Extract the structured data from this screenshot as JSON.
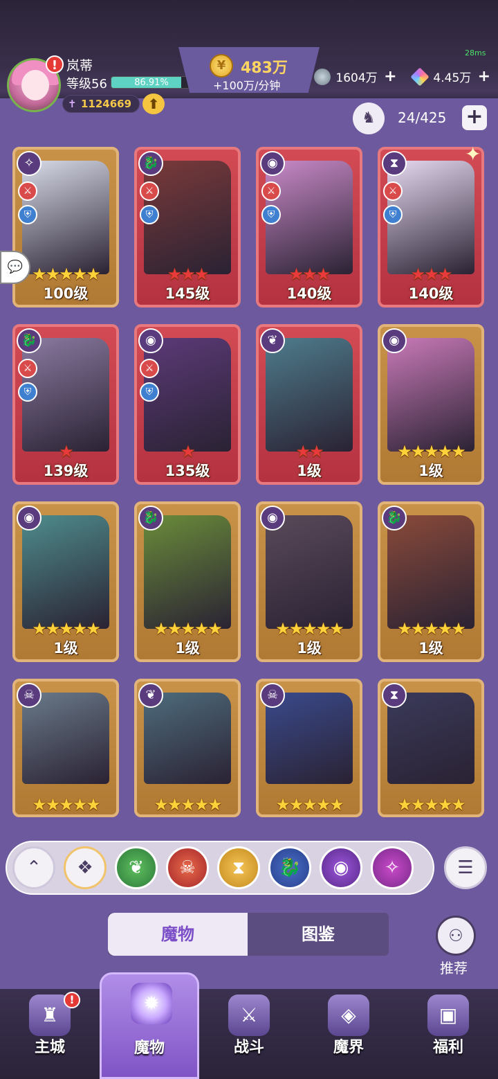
{
  "player": {
    "name": "岚蒂",
    "level_label": "等级56",
    "xp_percent_text": "86.91%",
    "xp_fraction": 0.8691,
    "power": "1124669",
    "alert_badge": "!"
  },
  "currency": {
    "gold_amount": "483万",
    "gold_rate": "+100万/分钟",
    "silver_amount": "1604万",
    "gem_amount": "4.45万",
    "plus": "+"
  },
  "ping": "28ms",
  "capacity": {
    "text": "24/425",
    "plus": "+"
  },
  "cards": [
    {
      "level": "100级",
      "stars": 5,
      "star_color": "gold",
      "frame": "gold",
      "faction_icon": "void-rune-icon",
      "show_class": true
    },
    {
      "level": "145级",
      "stars": 3,
      "star_color": "red",
      "frame": "red",
      "faction_icon": "dragon-icon",
      "show_class": true
    },
    {
      "level": "140级",
      "stars": 3,
      "star_color": "red",
      "frame": "red",
      "faction_icon": "eye-icon",
      "show_class": true
    },
    {
      "level": "140级",
      "stars": 3,
      "star_color": "red",
      "frame": "red",
      "faction_icon": "hourglass-icon",
      "show_class": true
    },
    {
      "level": "139级",
      "stars": 1,
      "star_color": "red",
      "frame": "red",
      "faction_icon": "dragon-icon",
      "show_class": true
    },
    {
      "level": "135级",
      "stars": 1,
      "star_color": "red",
      "frame": "red",
      "faction_icon": "eye-icon",
      "show_class": true
    },
    {
      "level": "1级",
      "stars": 2,
      "star_color": "red",
      "frame": "red",
      "faction_icon": "leaf-icon",
      "show_class": false
    },
    {
      "level": "1级",
      "stars": 5,
      "star_color": "gold",
      "frame": "gold",
      "faction_icon": "eye-icon",
      "show_class": false
    },
    {
      "level": "1级",
      "stars": 5,
      "star_color": "gold",
      "frame": "gold",
      "faction_icon": "eye-icon",
      "show_class": false
    },
    {
      "level": "1级",
      "stars": 5,
      "star_color": "gold",
      "frame": "gold",
      "faction_icon": "dragon-icon",
      "show_class": false
    },
    {
      "level": "1级",
      "stars": 5,
      "star_color": "gold",
      "frame": "gold",
      "faction_icon": "eye-icon",
      "show_class": false
    },
    {
      "level": "1级",
      "stars": 5,
      "star_color": "gold",
      "frame": "gold",
      "faction_icon": "dragon-icon",
      "show_class": false
    },
    {
      "level": "",
      "stars": 5,
      "star_color": "gold",
      "frame": "gold",
      "faction_icon": "demon-mask-icon",
      "show_class": false
    },
    {
      "level": "",
      "stars": 5,
      "star_color": "gold",
      "frame": "gold",
      "faction_icon": "leaf-icon",
      "show_class": false
    },
    {
      "level": "",
      "stars": 5,
      "star_color": "gold",
      "frame": "gold",
      "faction_icon": "demon-mask-icon",
      "show_class": false
    },
    {
      "level": "",
      "stars": 5,
      "star_color": "gold",
      "frame": "gold",
      "faction_icon": "hourglass-icon",
      "show_class": false
    }
  ],
  "filters": [
    "collapse-up-icon",
    "all-factions-icon",
    "leaf-icon",
    "demon-mask-icon",
    "hourglass-icon",
    "dragon-icon",
    "eye-icon",
    "void-rune-icon"
  ],
  "tabs": {
    "monsters": "魔物",
    "codex": "图鉴"
  },
  "recommend_label": "推荐",
  "nav": [
    {
      "label": "主城",
      "icon": "castle-icon",
      "badge": "!"
    },
    {
      "label": "魔物",
      "icon": "purple-flame-icon",
      "active": true
    },
    {
      "label": "战斗",
      "icon": "sword-shield-icon"
    },
    {
      "label": "魔界",
      "icon": "portal-icon"
    },
    {
      "label": "福利",
      "icon": "chest-icon"
    }
  ],
  "colors": {
    "background": "#6d5a9e",
    "gold_text": "#ffd561",
    "active_tab_text": "#7c4fc8"
  }
}
